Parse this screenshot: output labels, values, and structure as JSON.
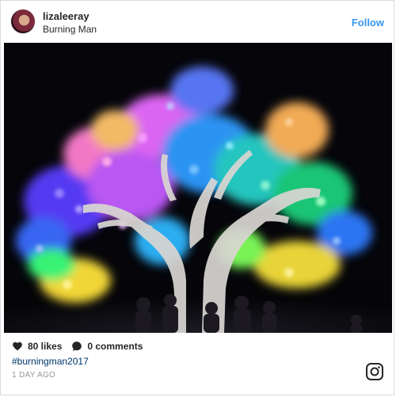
{
  "post": {
    "username": "lizaleeray",
    "location": "Burning Man",
    "follow_label": "Follow",
    "likes_text": "80 likes",
    "comments_text": "0 comments",
    "hashtag": "#burningman2017",
    "time_ago": "1 DAY AGO"
  },
  "icons": {
    "like": "heart-icon",
    "comment": "comment-bubble-icon",
    "brand": "instagram-icon"
  },
  "colors": {
    "follow": "#3897f0",
    "hashtag": "#003569",
    "text": "#262626",
    "muted": "#999999"
  }
}
